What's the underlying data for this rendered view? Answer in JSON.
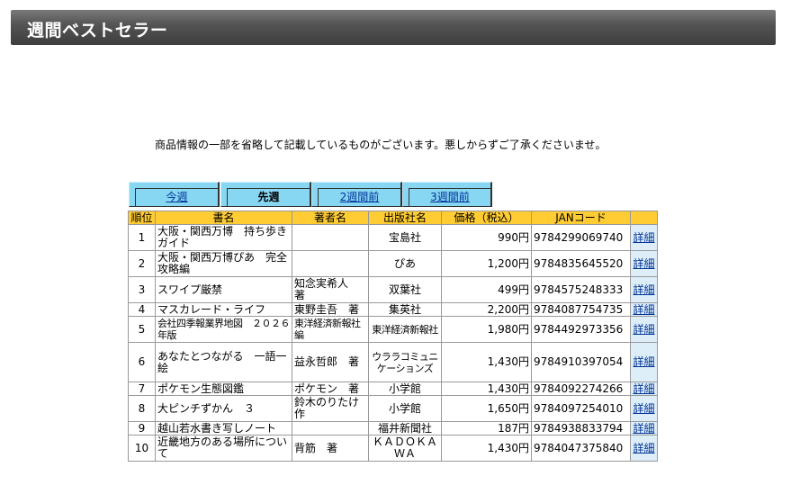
{
  "header": {
    "title": "週間ベストセラー"
  },
  "notice": "商品情報の一部を省略して記載しているものがございます。悪しからずご了承くださいませ。",
  "tabs": [
    {
      "label": "今週",
      "active": false
    },
    {
      "label": "先週",
      "active": true
    },
    {
      "label": "2週間前",
      "active": false
    },
    {
      "label": "3週間前",
      "active": false
    }
  ],
  "table": {
    "headers": [
      "順位",
      "書名",
      "著者名",
      "出版社名",
      "価格（税込）",
      "JANコード",
      ""
    ],
    "rows": [
      {
        "rank": "1",
        "title": "大阪・関西万博　持ち歩きガイド",
        "author": "",
        "publisher": "宝島社",
        "price": "990円",
        "jan": "9784299069740",
        "detail": "詳細"
      },
      {
        "rank": "2",
        "title": "大阪・関西万博ぴあ　完全攻略編",
        "author": "",
        "publisher": "ぴあ",
        "price": "1,200円",
        "jan": "9784835645520",
        "detail": "詳細"
      },
      {
        "rank": "3",
        "title": "スワイプ厳禁",
        "author": "知念実希人　著",
        "publisher": "双葉社",
        "price": "499円",
        "jan": "9784575248333",
        "detail": "詳細"
      },
      {
        "rank": "4",
        "title": "マスカレード・ライフ",
        "author": "東野圭吾　著",
        "publisher": "集英社",
        "price": "2,200円",
        "jan": "9784087754735",
        "detail": "詳細"
      },
      {
        "rank": "5",
        "title": "会社四季報業界地図　２０２６年版",
        "author": "東洋経済新報社　編",
        "publisher": "東洋経済新報社",
        "price": "1,980円",
        "jan": "9784492973356",
        "detail": "詳細"
      },
      {
        "rank": "6",
        "title": "あなたとつながる　一語一絵",
        "author": "益永哲郎　著",
        "publisher": "ウララコミュニケーションズ",
        "price": "1,430円",
        "jan": "9784910397054",
        "detail": "詳細"
      },
      {
        "rank": "7",
        "title": "ポケモン生態図鑑",
        "author": "ポケモン　著",
        "publisher": "小学館",
        "price": "1,430円",
        "jan": "9784092274266",
        "detail": "詳細"
      },
      {
        "rank": "8",
        "title": "大ピンチずかん　３",
        "author": "鈴木のりたけ　作",
        "publisher": "小学館",
        "price": "1,650円",
        "jan": "9784097254010",
        "detail": "詳細"
      },
      {
        "rank": "9",
        "title": "越山若水書き写しノート",
        "author": "",
        "publisher": "福井新聞社",
        "price": "187円",
        "jan": "9784938833794",
        "detail": "詳細"
      },
      {
        "rank": "10",
        "title": "近畿地方のある場所について",
        "author": "背筋　著",
        "publisher": "ＫＡＤＯＫＡＷＡ",
        "price": "1,430円",
        "jan": "9784047375840",
        "detail": "詳細"
      }
    ]
  }
}
